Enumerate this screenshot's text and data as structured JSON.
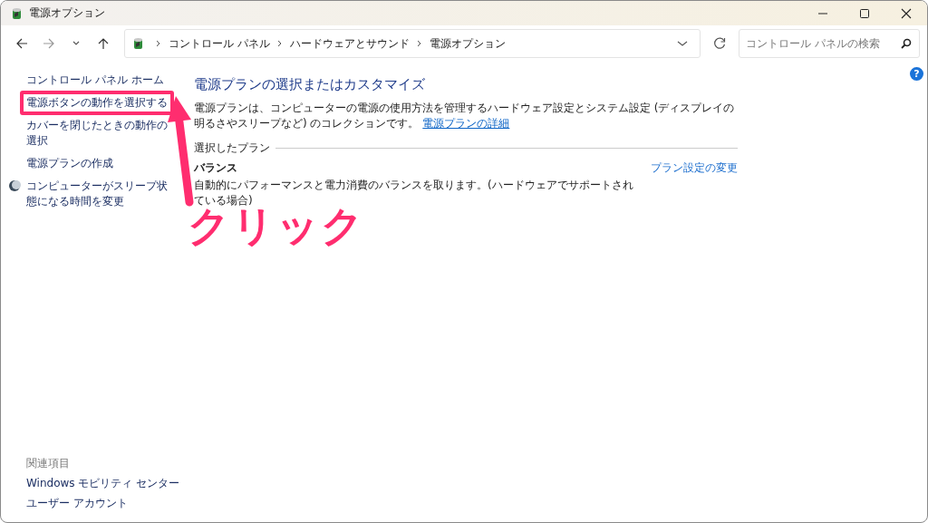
{
  "window": {
    "title": "電源オプション"
  },
  "navigation": {
    "breadcrumb": [
      "コントロール パネル",
      "ハードウェアとサウンド",
      "電源オプション"
    ],
    "search": {
      "placeholder": "コントロール パネルの検索"
    }
  },
  "sidebar": {
    "items": [
      {
        "label": "コントロール パネル ホーム",
        "kind": "link"
      },
      {
        "label": "電源ボタンの動作を選択する",
        "kind": "link"
      },
      {
        "label": "カバーを閉じたときの動作の選択",
        "kind": "link"
      },
      {
        "label": "電源プランの作成",
        "kind": "link"
      },
      {
        "label": "コンピューターがスリープ状態になる時間を変更",
        "kind": "icon-link"
      }
    ],
    "related_heading": "関連項目",
    "related": [
      "Windows モビリティ センター",
      "ユーザー アカウント"
    ]
  },
  "main": {
    "heading": "電源プランの選択またはカスタマイズ",
    "description": "電源プランは、コンピューターの電源の使用方法を管理するハードウェア設定とシステム設定 (ディスプレイの明るさやスリープなど) のコレクションです。",
    "details_link": "電源プランの詳細",
    "section_label": "選択したプラン",
    "plans": [
      {
        "name": "バランス",
        "description": "自動的にパフォーマンスと電力消費のバランスを取ります。(ハードウェアでサポートされている場合)",
        "settings_link": "プラン設定の変更"
      }
    ]
  },
  "help_button": {
    "label": "?"
  },
  "annotation": {
    "callout": "クリック"
  }
}
